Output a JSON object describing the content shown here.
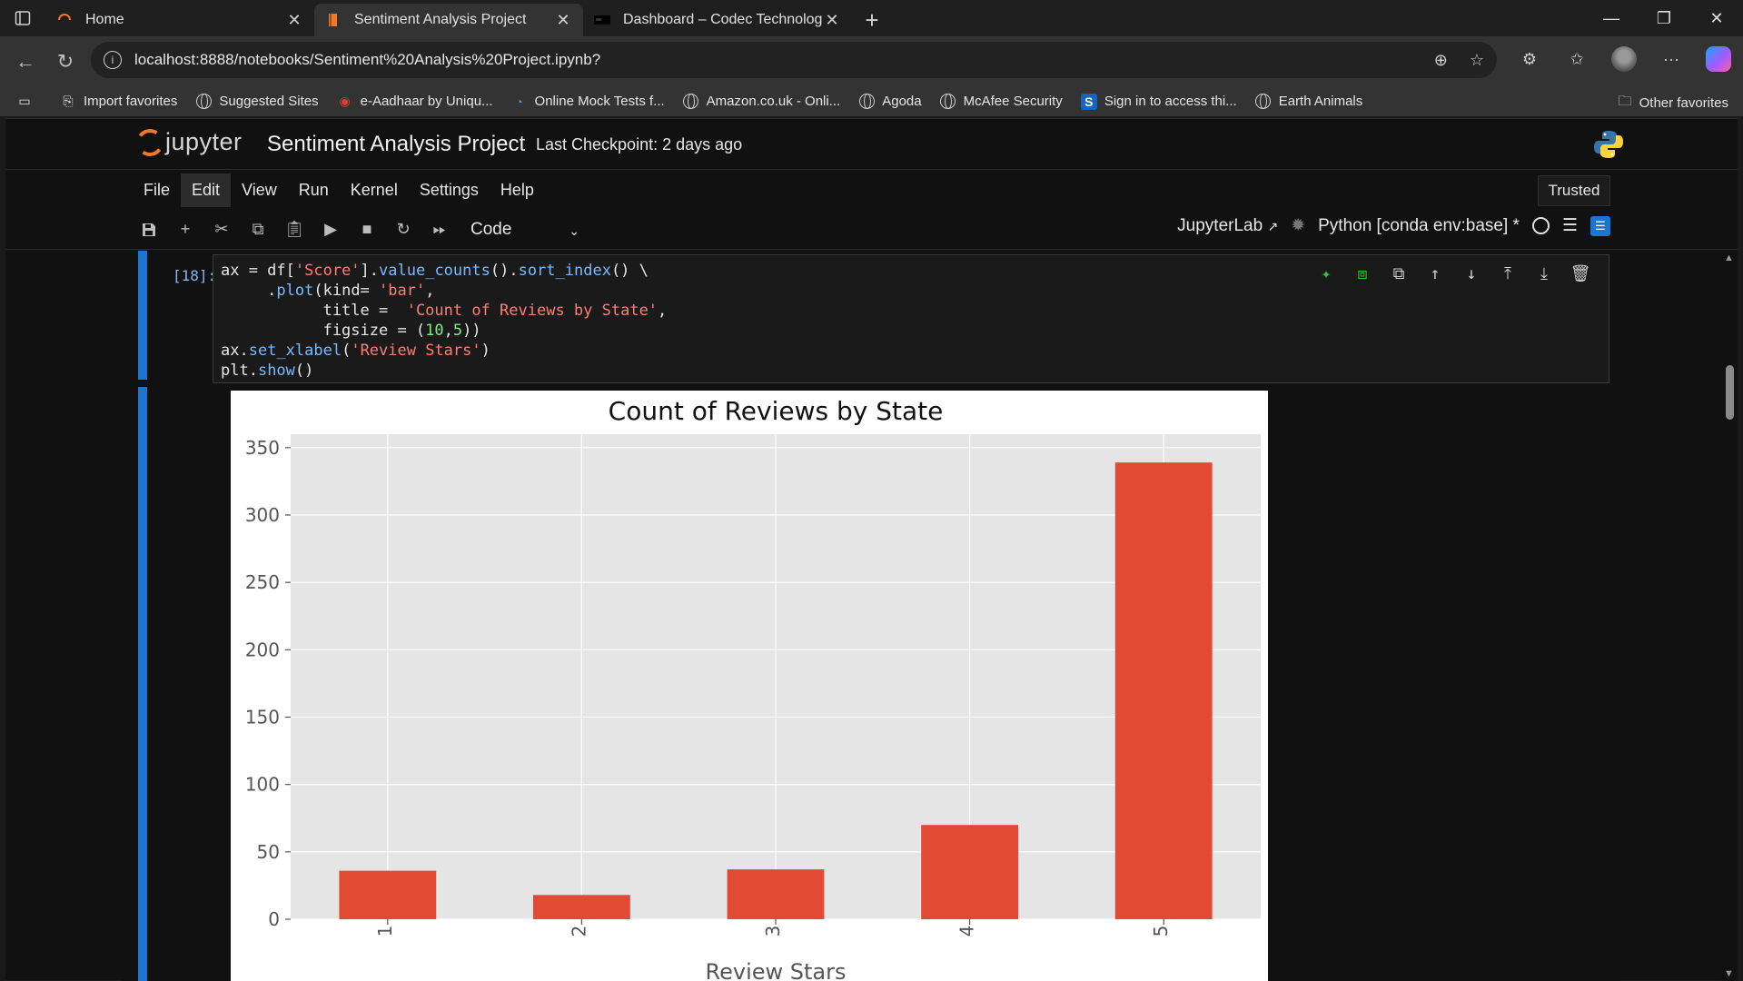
{
  "browser": {
    "tabs": [
      {
        "title": "Home",
        "active": false
      },
      {
        "title": "Sentiment Analysis Project",
        "active": true
      },
      {
        "title": "Dashboard – Codec Technologies",
        "active": false
      }
    ],
    "url": "localhost:8888/notebooks/Sentiment%20Analysis%20Project.ipynb?",
    "favorites": [
      {
        "label": "Import favorites",
        "icon": "import-icon"
      },
      {
        "label": "Suggested Sites",
        "icon": "globe-icon"
      },
      {
        "label": "e-Aadhaar by Uniqu...",
        "icon": "aadhaar-icon"
      },
      {
        "label": "Online Mock Tests f...",
        "icon": "mocktest-icon"
      },
      {
        "label": "Amazon.co.uk - Onli...",
        "icon": "globe-icon"
      },
      {
        "label": "Agoda",
        "icon": "globe-icon"
      },
      {
        "label": "McAfee Security",
        "icon": "globe-icon"
      },
      {
        "label": "Sign in to access thi...",
        "icon": "s-icon"
      },
      {
        "label": "Earth Animals",
        "icon": "globe-icon"
      }
    ],
    "other_favorites": "Other favorites"
  },
  "jupyter": {
    "logo_text": "jupyter",
    "notebook_title": "Sentiment Analysis Project",
    "checkpoint": "Last Checkpoint: 2 days ago",
    "menu": [
      "File",
      "Edit",
      "View",
      "Run",
      "Kernel",
      "Settings",
      "Help"
    ],
    "trusted": "Trusted",
    "cell_type": "Code",
    "jupyterlab_link": "JupyterLab",
    "kernel_name": "Python [conda env:base] *"
  },
  "cell": {
    "prompt": "[18]:",
    "code_lines": [
      "ax = df['Score'].value_counts().sort_index() \\",
      "    .plot(kind= 'bar',",
      "          title =  'Count of Reviews by State',",
      "          figsize = (10,5))",
      "ax.set_xlabel('Review Stars')",
      "plt.show()"
    ]
  },
  "colors": {
    "accent": "#1976d2",
    "bar": "#e24a33",
    "plot_bg": "#e5e5e5"
  },
  "chart_data": {
    "type": "bar",
    "title": "Count of Reviews by State",
    "xlabel": "Review Stars",
    "ylabel": "",
    "categories": [
      "1",
      "2",
      "3",
      "4",
      "5"
    ],
    "values": [
      36,
      18,
      37,
      70,
      339
    ],
    "ylim": [
      0,
      360
    ],
    "yticks": [
      0,
      50,
      100,
      150,
      200,
      250,
      300,
      350
    ],
    "grid": true,
    "legend": "none"
  }
}
